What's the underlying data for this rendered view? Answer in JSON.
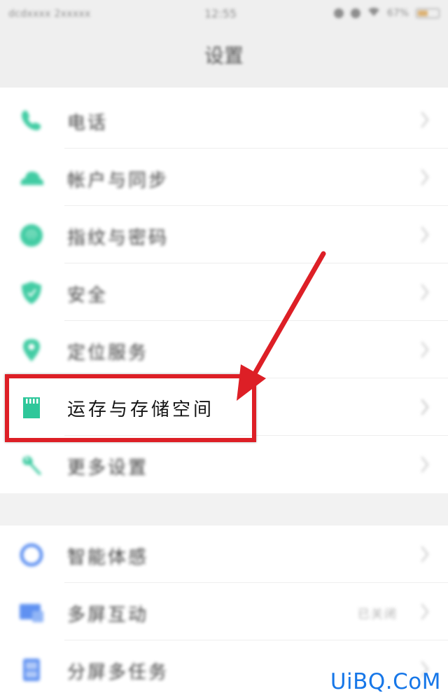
{
  "status_bar": {
    "carrier": "dcdxxxx 2xxxxx",
    "time": "12:55",
    "battery": "67%"
  },
  "header": {
    "title": "设置"
  },
  "settings_group_1": [
    {
      "label": "电话",
      "icon": "phone-icon",
      "color": "#2ec79a"
    },
    {
      "label": "帐户与同步",
      "icon": "cloud-icon",
      "color": "#2ec79a"
    },
    {
      "label": "指纹与密码",
      "icon": "fingerprint-icon",
      "color": "#2ec79a"
    },
    {
      "label": "安全",
      "icon": "shield-icon",
      "color": "#2ec79a"
    },
    {
      "label": "定位服务",
      "icon": "location-icon",
      "color": "#2ec79a"
    },
    {
      "label": "运存与存储空间",
      "icon": "sd-card-icon",
      "color": "#2ec79a"
    },
    {
      "label": "更多设置",
      "icon": "wrench-icon",
      "color": "#2ec79a"
    }
  ],
  "settings_group_2": [
    {
      "label": "智能体感",
      "icon": "smart-motion-icon",
      "color": "#4f86f0"
    },
    {
      "label": "多屏互动",
      "icon": "multi-screen-icon",
      "color": "#4f86f0",
      "value": "已关闭"
    },
    {
      "label": "分屏多任务",
      "icon": "split-screen-icon",
      "color": "#4f86f0"
    }
  ],
  "annotation": {
    "highlight_color": "#dd1f26"
  },
  "watermark": {
    "text": "UiBQ.CoM",
    "color": "#1777e8"
  }
}
